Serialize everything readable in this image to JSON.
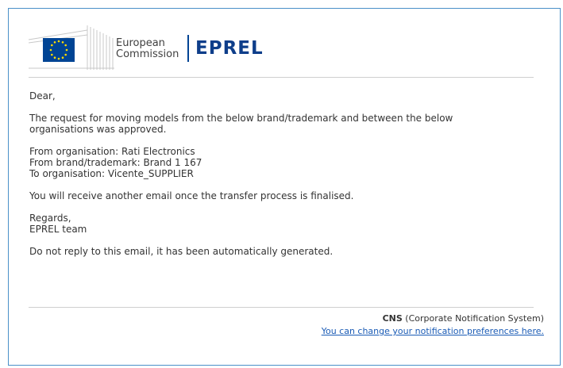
{
  "logo": {
    "line1": "European",
    "line2": "Commission",
    "product": "EPREL",
    "flag_color": "#004494",
    "star_color": "#ffdd00"
  },
  "email": {
    "greeting": "Dear,",
    "intro_line1": "The request for moving models from the below brand/trademark and between the below",
    "intro_line2": "organisations was approved.",
    "from_org": "From organisation: Rati Electronics",
    "from_brand": "From brand/trademark: Brand 1 167",
    "to_org": "To organisation: Vicente_SUPPLIER",
    "next_step": "You will receive another email once the transfer process is finalised.",
    "regards": "Regards,",
    "team": "EPREL team",
    "no_reply": "Do not reply to this email, it has been automatically generated."
  },
  "footer": {
    "system_short": "CNS",
    "system_full": "(Corporate Notification System)",
    "preferences_link": "You can change your notification preferences here."
  },
  "colors": {
    "border": "#4a90c8",
    "link": "#1a5bb5",
    "brand": "#0e3e8a"
  }
}
